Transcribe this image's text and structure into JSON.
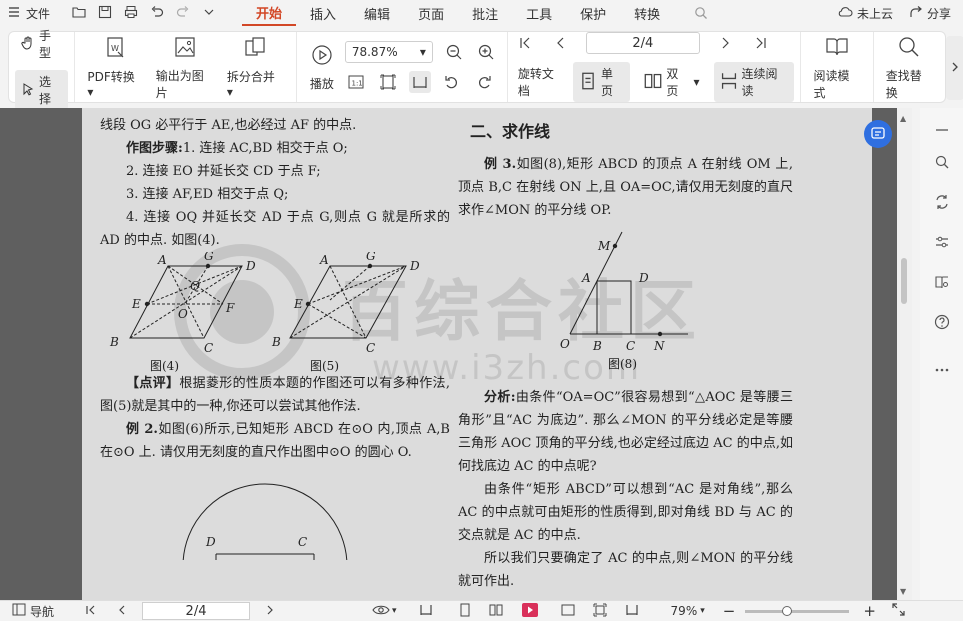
{
  "menubar": {
    "file_label": "文件",
    "tabs": [
      {
        "label": "开始",
        "active": true
      },
      {
        "label": "插入",
        "active": false
      },
      {
        "label": "编辑",
        "active": false
      },
      {
        "label": "页面",
        "active": false
      },
      {
        "label": "批注",
        "active": false
      },
      {
        "label": "工具",
        "active": false
      },
      {
        "label": "保护",
        "active": false
      },
      {
        "label": "转换",
        "active": false
      }
    ],
    "cloud_label": "未上云",
    "share_label": "分享"
  },
  "ribbon": {
    "hand_label": "手型",
    "select_label": "选择",
    "pdf_convert_label": "PDF转换",
    "export_image_label": "输出为图片",
    "split_merge_label": "拆分合并",
    "play_label": "播放",
    "zoom_value": "78.87%",
    "page_value": "2/4",
    "rotate_label": "旋转文档",
    "single_label": "单页",
    "double_label": "双页",
    "continuous_label": "连续阅读",
    "reading_mode_label": "阅读模式",
    "find_replace_label": "查找替换"
  },
  "document": {
    "left": {
      "l1": "线段 OG 必平行于 AE,也必经过 AF 的中点.",
      "steps_title": "作图步骤:",
      "s1": "1. 连接 AC,BD 相交于点 O;",
      "s2": "2. 连接 EO 并延长交 CD 于点 F;",
      "s3": "3. 连接 AF,ED 相交于点 Q;",
      "s4": "4. 连接 OQ 并延长交 AD 于点 G,则点 G 就是所求的 AD 的中点. 如图(4).",
      "fig4_caption": "图(4)",
      "fig5_caption": "图(5)",
      "comment_title": "【点评】",
      "comment": "根据菱形的性质本题的作图还可以有多种作法,图(5)就是其中的一种,你还可以尝试其他作法.",
      "ex2_title": "例 2.",
      "ex2": "如图(6)所示,已知矩形 ABCD 在⊙O 内,顶点 A,B 在⊙O 上. 请仅用无刻度的直尺作出图中⊙O 的圆心 O."
    },
    "right": {
      "section_title": "二、求作线",
      "ex3_title": "例 3.",
      "ex3": "如图(8),矩形 ABCD 的顶点 A 在射线 OM 上,顶点 B,C 在射线 ON 上,且 OA=OC,请仅用无刻度的直尺求作∠MON 的平分线 OP.",
      "fig8_caption": "图(8)",
      "analysis_title": "分析:",
      "analysis": "由条件“OA=OC”很容易想到“△AOC 是等腰三角形”且“AC 为底边”. 那么∠MON 的平分线必定是等腰三角形 AOC 顶角的平分线,也必定经过底边 AC 的中点,如何找底边 AC 的中点呢?",
      "p2": "由条件“矩形 ABCD”可以想到“AC 是对角线”,那么 AC 的中点就可由矩形的性质得到,即对角线 BD 与 AC 的交点就是 AC 的中点.",
      "p3": "所以我们只要确定了 AC 的中点,则∠MON 的平分线就可作出."
    },
    "figure_labels": {
      "A": "A",
      "B": "B",
      "C": "C",
      "D": "D",
      "E": "E",
      "F": "F",
      "G": "G",
      "O": "O",
      "Q": "Q",
      "M": "M",
      "N": "N"
    },
    "watermark": {
      "text": "百综合社区",
      "url": "www.i3zh.com"
    }
  },
  "statusbar": {
    "nav_label": "导航",
    "page_value": "2/4",
    "zoom_value": "79%",
    "zoom_fraction": 0.4
  },
  "colors": {
    "accent": "#d24726",
    "page_bg": "#dcdcdc",
    "doc_bg": "#5f5f5f",
    "float_btn": "#2f6fe0"
  }
}
